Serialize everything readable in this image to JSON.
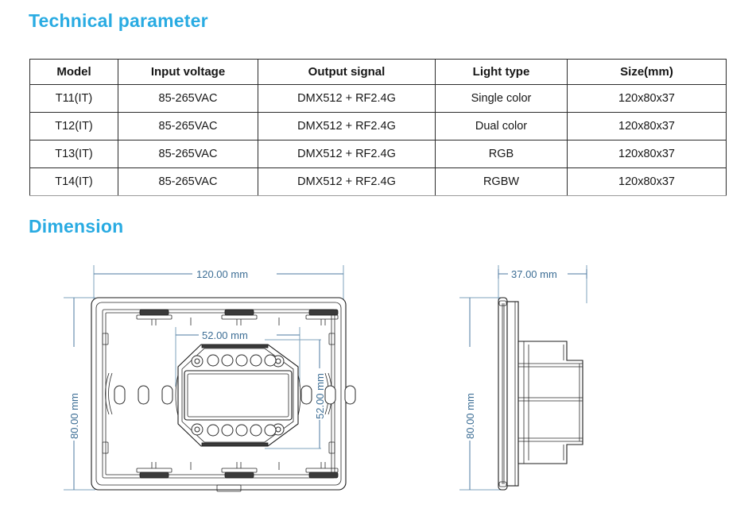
{
  "sections": {
    "technical_heading": "Technical parameter",
    "dimension_heading": "Dimension"
  },
  "spec_table": {
    "columns": [
      "Model",
      "Input voltage",
      "Output signal",
      "Light type",
      "Size(mm)"
    ],
    "rows": [
      [
        "T11(IT)",
        "85-265VAC",
        "DMX512 + RF2.4G",
        "Single color",
        "120x80x37"
      ],
      [
        "T12(IT)",
        "85-265VAC",
        "DMX512 + RF2.4G",
        "Dual color",
        "120x80x37"
      ],
      [
        "T13(IT)",
        "85-265VAC",
        "DMX512 + RF2.4G",
        "RGB",
        "120x80x37"
      ],
      [
        "T14(IT)",
        "85-265VAC",
        "DMX512 + RF2.4G",
        "RGBW",
        "120x80x37"
      ]
    ]
  },
  "dimension_drawing": {
    "front_view": {
      "width_label": "120.00 mm",
      "height_label": "80.00 mm",
      "inner_width_label": "52.00 mm",
      "inner_height_label": "52.00 mm"
    },
    "side_view": {
      "depth_label": "37.00 mm",
      "height_label": "80.00 mm"
    }
  },
  "colors": {
    "heading_blue": "#29ABE2",
    "dimension_blue": "#3D6E95",
    "table_border": "#2b2b2b"
  }
}
